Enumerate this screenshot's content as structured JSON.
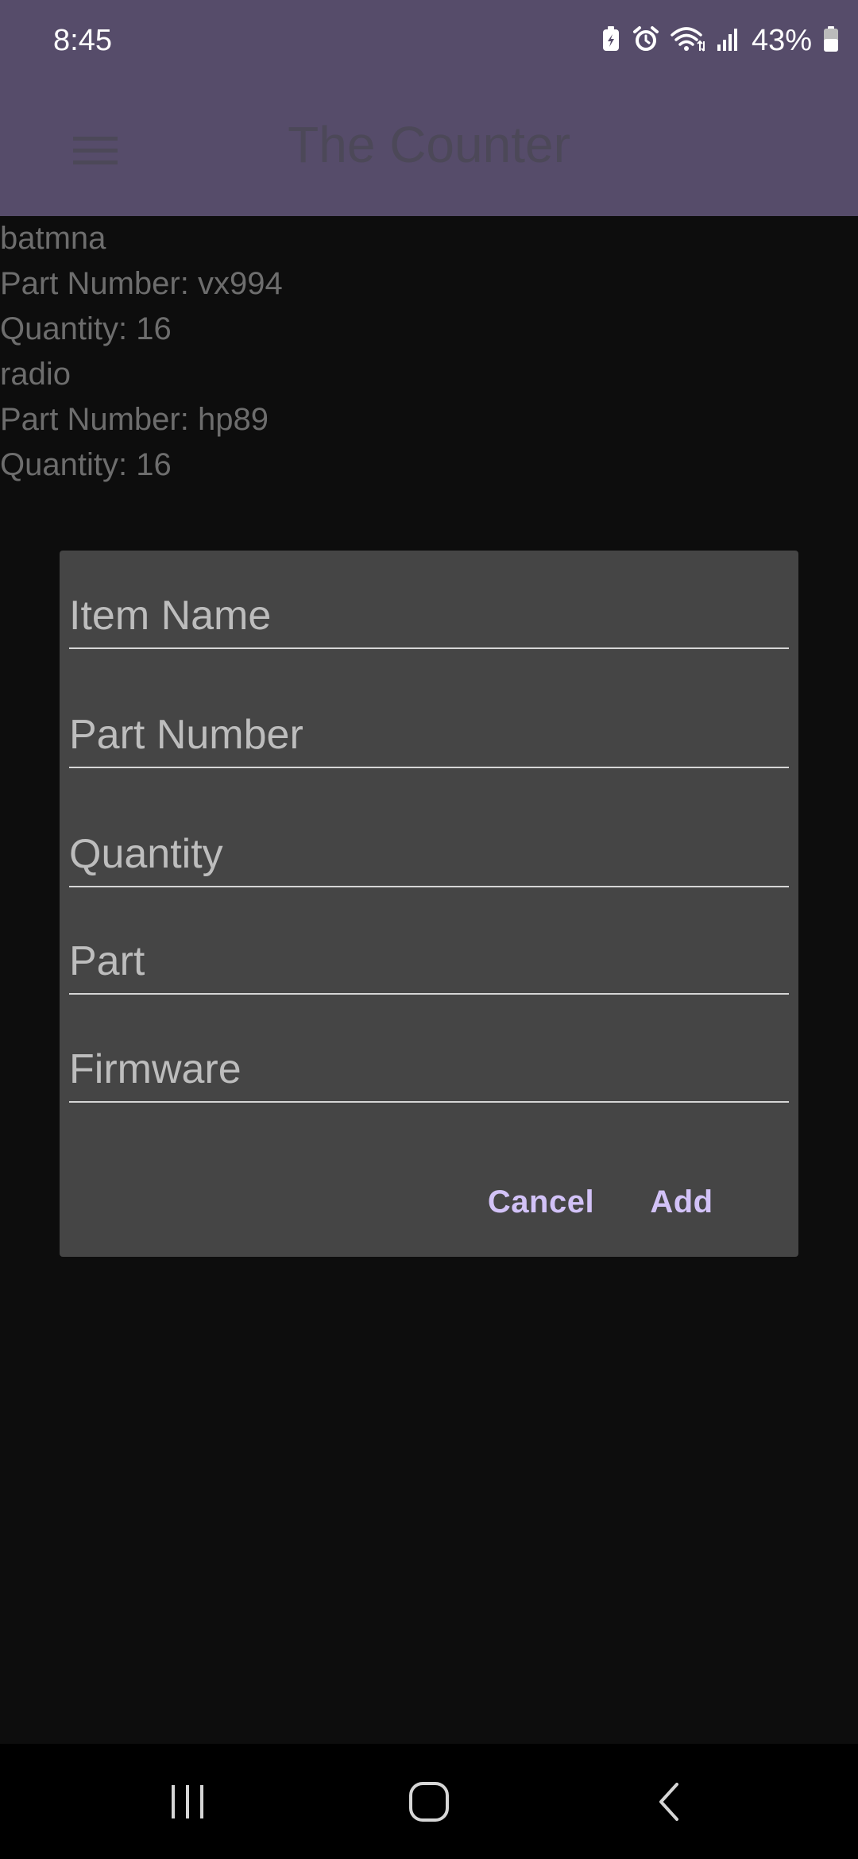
{
  "status_bar": {
    "time": "8:45",
    "battery_percent": "43%",
    "icons": [
      "battery-saver-icon",
      "alarm-icon",
      "wifi-icon",
      "signal-icon",
      "battery-icon"
    ]
  },
  "app_bar": {
    "title": "The Counter",
    "menu_icon": "hamburger-menu-icon"
  },
  "items": [
    {
      "name": "batmna",
      "part_number": "Part Number: vx994",
      "quantity": "Quantity: 16"
    },
    {
      "name": "radio",
      "part_number": "Part Number: hp89",
      "quantity": "Quantity: 16"
    }
  ],
  "dialog": {
    "fields": {
      "item_name": {
        "value": "",
        "placeholder": "Item Name"
      },
      "part_number": {
        "value": "",
        "placeholder": "Part Number"
      },
      "quantity": {
        "value": "",
        "placeholder": "Quantity"
      },
      "part": {
        "value": "",
        "placeholder": "Part"
      },
      "firmware": {
        "value": "",
        "placeholder": "Firmware"
      }
    },
    "cancel_label": "Cancel",
    "add_label": "Add"
  },
  "nav_bar": {
    "recents_icon": "recents-icon",
    "home_icon": "home-icon",
    "back_icon": "back-icon"
  },
  "colors": {
    "app_bar": "#564c6a",
    "dialog_background": "#454545",
    "accent": "#d2c2f7",
    "screen_background": "#0d0d0d"
  }
}
